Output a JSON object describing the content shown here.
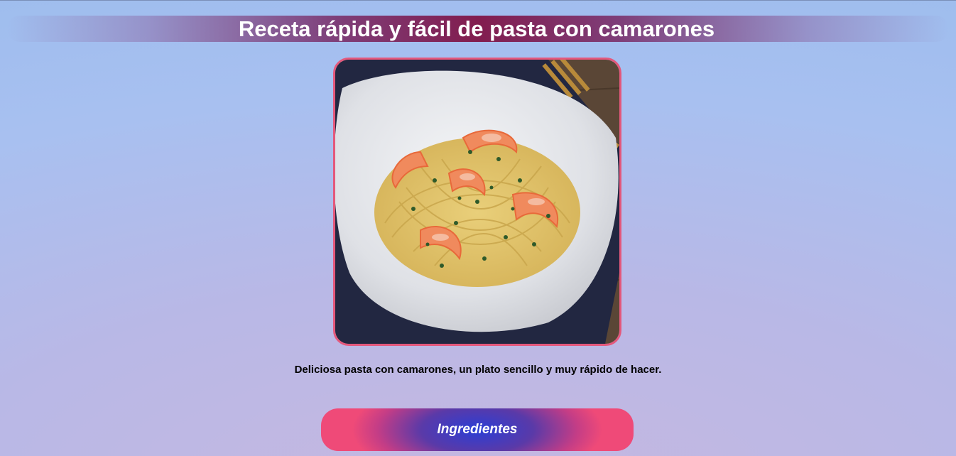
{
  "page": {
    "title": "Receta rápida y fácil de pasta con camarones",
    "description": "Deliciosa pasta con camarones, un plato sencillo y muy rápido de hacer."
  },
  "photo": {
    "alt": "Pasta con camarones"
  },
  "actions": {
    "ingredients_label": "Ingredientes"
  },
  "colors": {
    "frame_border": "#e4587c",
    "title_band": "#801446",
    "button_center": "#2a3ed6",
    "button_edge": "#ef4a78"
  }
}
